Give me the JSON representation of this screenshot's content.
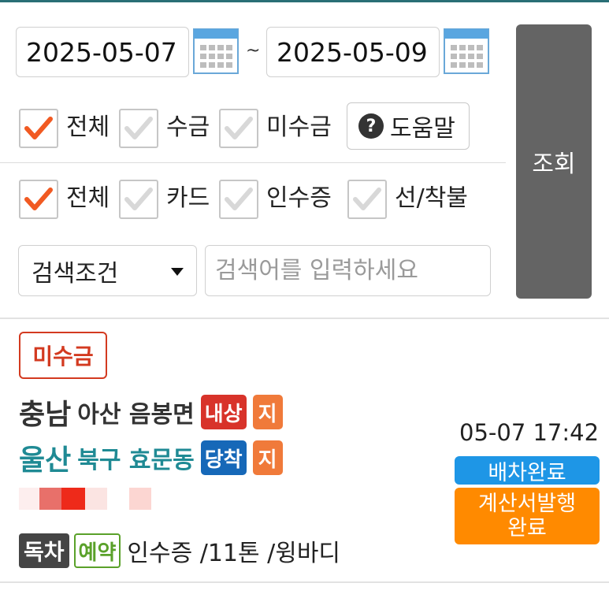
{
  "filters": {
    "start_date": "2025-05-07",
    "end_date": "2025-05-09",
    "range_separator": "~",
    "search_button": "조회",
    "help_label": "도움말",
    "payment_filters": [
      {
        "label": "전체",
        "checked": true
      },
      {
        "label": "수금",
        "checked": false
      },
      {
        "label": "미수금",
        "checked": false
      }
    ],
    "method_filters": [
      {
        "label": "전체",
        "checked": true
      },
      {
        "label": "카드",
        "checked": false
      },
      {
        "label": "인수증",
        "checked": false
      },
      {
        "label": "선/착불",
        "checked": false
      }
    ],
    "condition_select": "검색조건",
    "search_placeholder": "검색어를 입력하세요"
  },
  "order": {
    "payment_status": "미수금",
    "origin": {
      "province": "충남",
      "district": "아산 음봉면",
      "tag": "내상",
      "tag2": "지"
    },
    "destination": {
      "province": "울산",
      "district": "북구 효문동",
      "tag": "당착",
      "tag2": "지"
    },
    "time": "05-07 17:42",
    "dispatch_status": "배차완료",
    "invoice_status_line1": "계산서발행",
    "invoice_status_line2": "완료",
    "vehicle_type": "독차",
    "reservation": "예약",
    "description": "인수증 /11톤 /윙바디",
    "colors": {
      "accent_teal": "#1f8a94",
      "unpaid_red": "#d33a20",
      "dispatch_blue": "#1e96e6",
      "invoice_orange": "#ff8a00",
      "checkmark": "#f15a22"
    }
  }
}
